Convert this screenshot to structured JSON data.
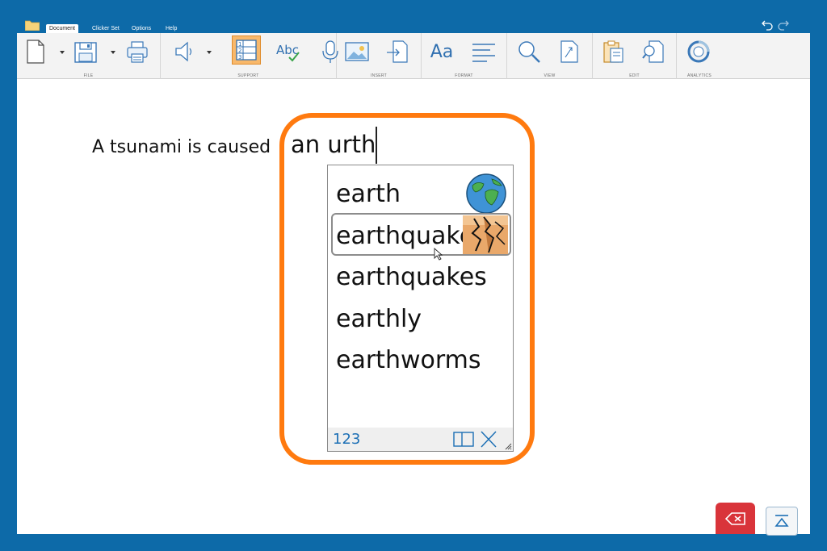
{
  "menu": {
    "tabs": [
      {
        "label": "Document",
        "active": true
      },
      {
        "label": "Clicker Set",
        "active": false
      },
      {
        "label": "Options",
        "active": false
      },
      {
        "label": "Help",
        "active": false
      }
    ]
  },
  "ribbon": {
    "groups": {
      "file": "FILE",
      "support": "SUPPORT",
      "insert": "INSERT",
      "format": "FORMAT",
      "view": "VIEW",
      "edit": "EDIT",
      "analytics": "ANALYTICS"
    },
    "format_label": "Aa",
    "spell_label": "Abc",
    "list_numbers": [
      "1",
      "2",
      "3"
    ]
  },
  "document": {
    "sentence_start": "A tsunami is caused",
    "typed_text": "an urth"
  },
  "prediction": {
    "words": [
      {
        "label": "earth",
        "icon": "earth-globe-icon",
        "selected": false
      },
      {
        "label": "earthquake",
        "icon": "earthquake-icon",
        "selected": true
      },
      {
        "label": "earthquakes",
        "icon": "",
        "selected": false
      },
      {
        "label": "earthly",
        "icon": "",
        "selected": false
      },
      {
        "label": "earthworms",
        "icon": "",
        "selected": false
      }
    ],
    "numbers_button": "123"
  },
  "colors": {
    "frame": "#0d6aa8",
    "highlight_ring": "#ff7a0f",
    "delete": "#d9343a",
    "accent": "#1c6fb5"
  }
}
